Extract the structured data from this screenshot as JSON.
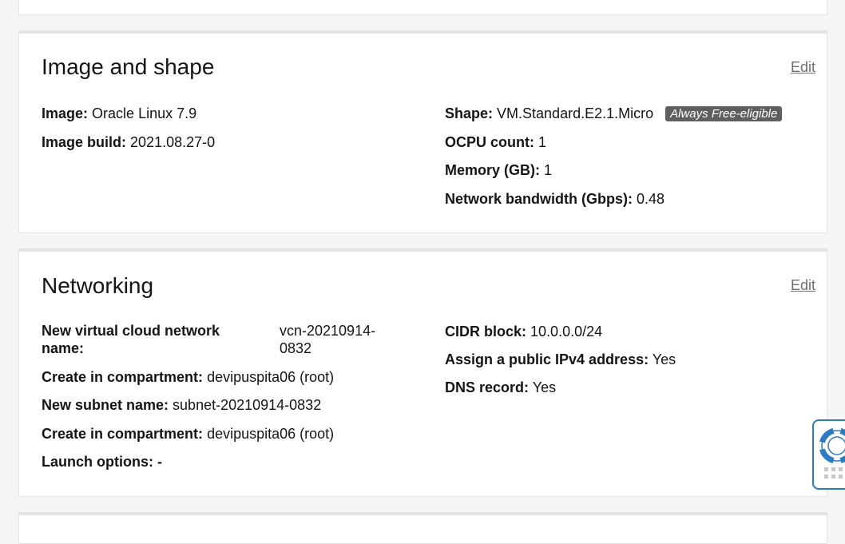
{
  "image_section": {
    "title": "Image and shape",
    "edit_label": "Edit",
    "image_label": "Image:",
    "image_value": "Oracle Linux 7.9",
    "image_build_label": "Image build:",
    "image_build_value": "2021.08.27-0",
    "shape_label": "Shape:",
    "shape_value": "VM.Standard.E2.1.Micro",
    "free_badge": "Always Free-eligible",
    "ocpu_label": "OCPU count:",
    "ocpu_value": "1",
    "memory_label": "Memory (GB):",
    "memory_value": "1",
    "bandwidth_label": "Network bandwidth (Gbps):",
    "bandwidth_value": "0.48"
  },
  "networking_section": {
    "title": "Networking",
    "edit_label": "Edit",
    "vcn_name_label": "New virtual cloud network name:",
    "vcn_name_value": "vcn-20210914-0832",
    "vcn_compartment_label": "Create in compartment:",
    "vcn_compartment_value": "devipuspita06 (root)",
    "subnet_name_label": "New subnet name:",
    "subnet_name_value": "subnet-20210914-0832",
    "subnet_compartment_label": "Create in compartment:",
    "subnet_compartment_value": "devipuspita06 (root)",
    "launch_options_label": "Launch options:",
    "launch_options_value": "-",
    "cidr_label": "CIDR block:",
    "cidr_value": "10.0.0.0/24",
    "public_ip_label": "Assign a public IPv4 address:",
    "public_ip_value": "Yes",
    "dns_label": "DNS record:",
    "dns_value": "Yes"
  },
  "help_widget": {
    "icon": "lifebuoy-icon",
    "grip_icon": "drag-grip-icon",
    "accent_color": "#2c7cc1"
  }
}
